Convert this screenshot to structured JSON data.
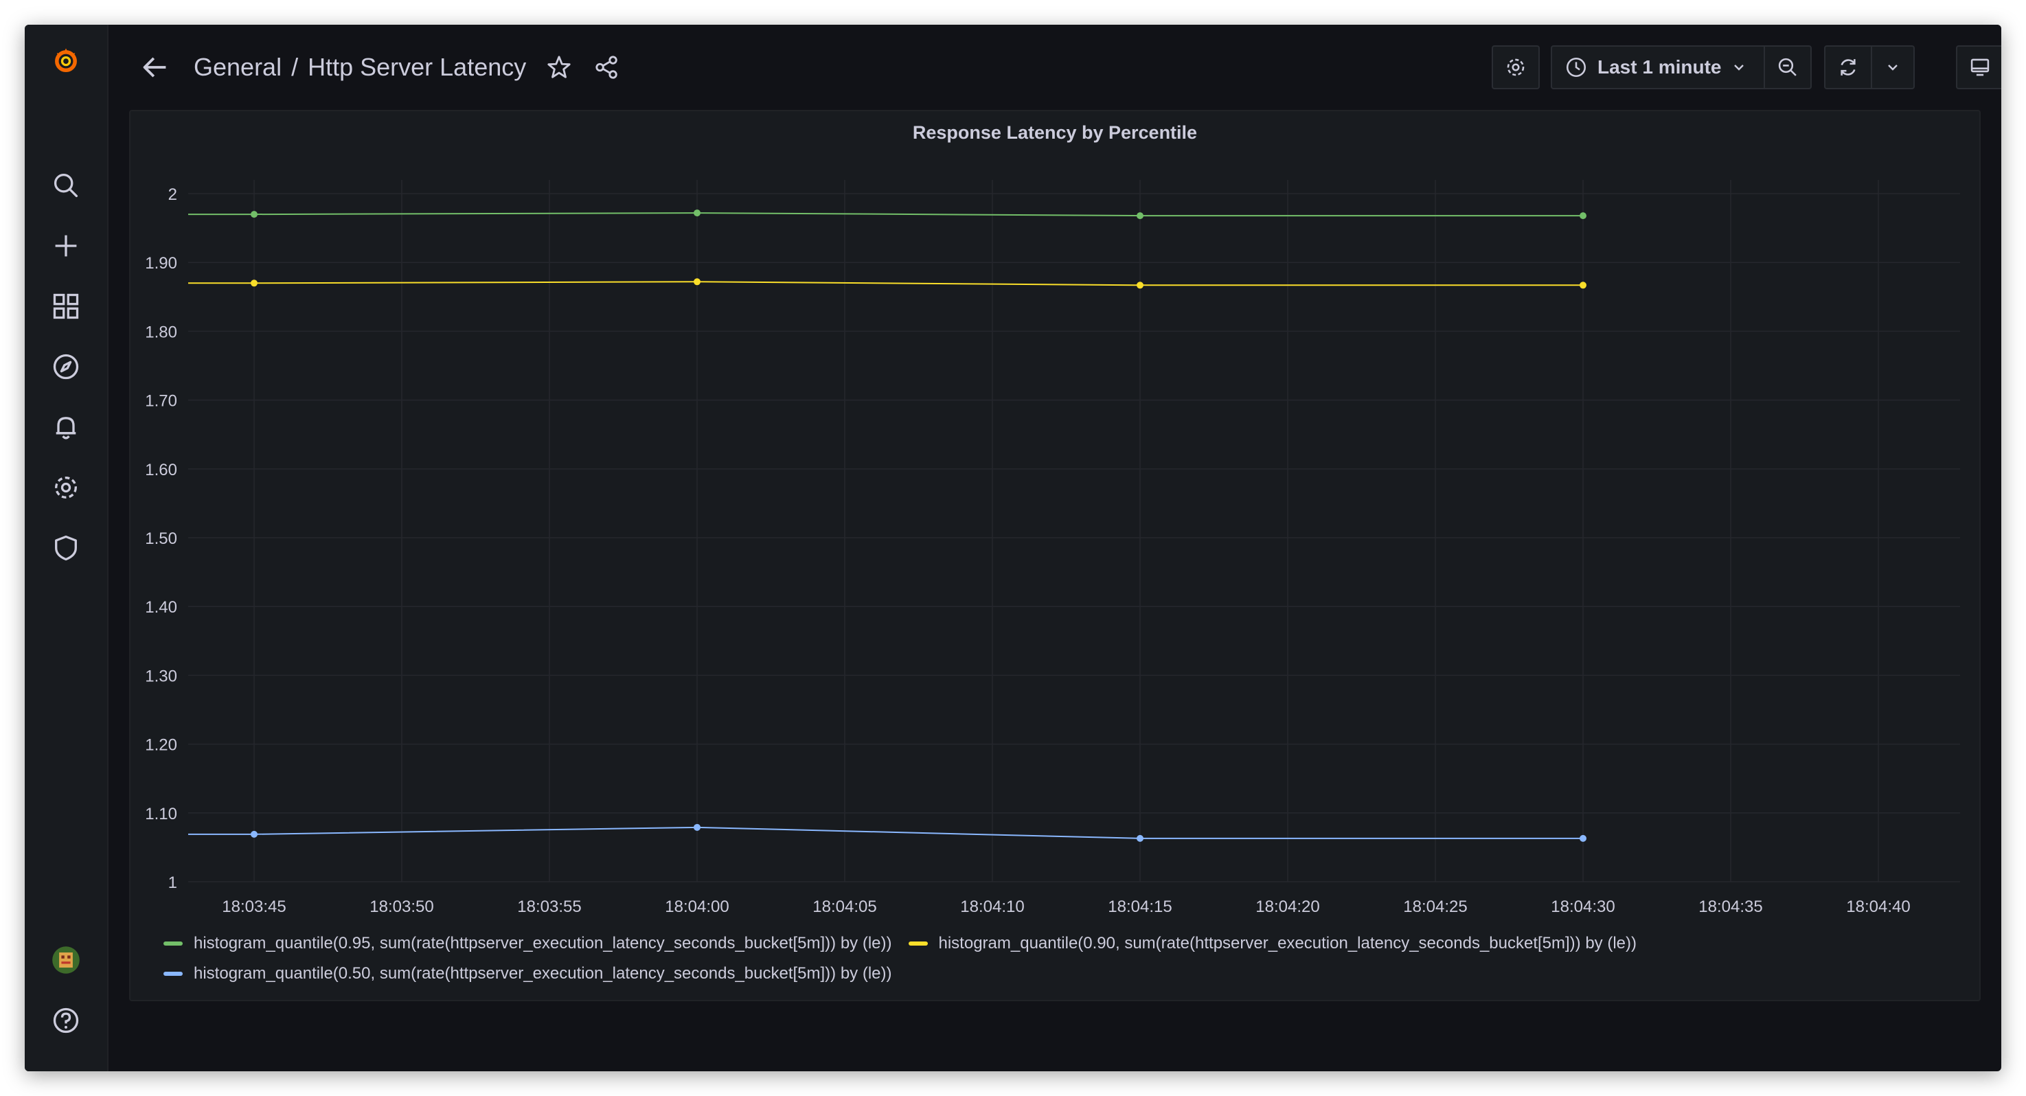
{
  "header": {
    "folder": "General",
    "separator": "/",
    "dashboard_title": "Http Server Latency",
    "time_range": "Last 1 minute"
  },
  "sidebar": {
    "items": [
      {
        "icon": "grafana-logo-icon"
      },
      {
        "icon": "search-icon"
      },
      {
        "icon": "plus-icon"
      },
      {
        "icon": "dashboards-icon"
      },
      {
        "icon": "explore-compass-icon"
      },
      {
        "icon": "alerting-bell-icon"
      },
      {
        "icon": "configuration-gear-icon"
      },
      {
        "icon": "shield-icon"
      },
      {
        "icon": "avatar"
      },
      {
        "icon": "help-icon"
      }
    ]
  },
  "colors": {
    "background": "#111217",
    "panel": "#181b1f",
    "text": "#ccccdc",
    "grid": "#25272d",
    "green": "#73bf69",
    "yellow": "#fade2a",
    "blue": "#8ab8ff",
    "logo": "#f46800"
  },
  "chart_data": {
    "type": "line",
    "title": "Response Latency by Percentile",
    "xlabel": "",
    "ylabel": "",
    "x": [
      "18:03:45",
      "18:04:00",
      "18:04:15",
      "18:04:30"
    ],
    "x_ticks": [
      "18:03:45",
      "18:03:50",
      "18:03:55",
      "18:04:00",
      "18:04:05",
      "18:04:10",
      "18:04:15",
      "18:04:20",
      "18:04:25",
      "18:04:30",
      "18:04:35",
      "18:04:40"
    ],
    "y_ticks": [
      "1",
      "1.10",
      "1.20",
      "1.30",
      "1.40",
      "1.50",
      "1.60",
      "1.70",
      "1.80",
      "1.90",
      "2"
    ],
    "ylim": [
      1.0,
      2.02
    ],
    "grid": true,
    "legend_position": "bottom",
    "series": [
      {
        "name": "histogram_quantile(0.95, sum(rate(httpserver_execution_latency_seconds_bucket[5m])) by (le))",
        "color": "#73bf69",
        "values": [
          1.97,
          1.972,
          1.968,
          1.968
        ]
      },
      {
        "name": "histogram_quantile(0.90, sum(rate(httpserver_execution_latency_seconds_bucket[5m])) by (le))",
        "color": "#fade2a",
        "values": [
          1.87,
          1.872,
          1.867,
          1.867
        ]
      },
      {
        "name": "histogram_quantile(0.50, sum(rate(httpserver_execution_latency_seconds_bucket[5m])) by (le))",
        "color": "#8ab8ff",
        "values": [
          1.069,
          1.079,
          1.063,
          1.063
        ]
      }
    ]
  }
}
